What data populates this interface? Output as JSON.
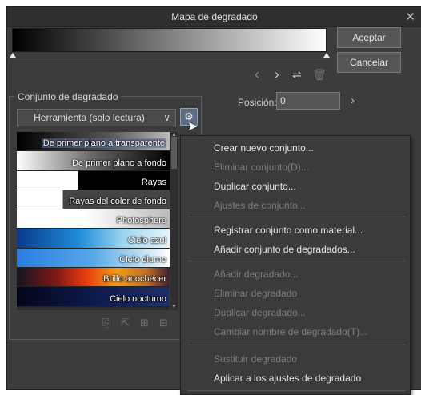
{
  "window": {
    "title": "Mapa de degradado",
    "close_glyph": "✕"
  },
  "buttons": {
    "ok": "Aceptar",
    "cancel": "Cancelar"
  },
  "nav": {
    "prev_glyph": "‹",
    "next_glyph": "›",
    "flip_glyph": "⇌",
    "trash_glyph": "🗑"
  },
  "position": {
    "label": "Posición:",
    "value": "0",
    "arrow": "›"
  },
  "gradient_set": {
    "group_label": "Conjunto de degradado",
    "selected": "Herramienta (solo lectura)",
    "chevron": "∨",
    "gear_glyph": "⚙",
    "items": [
      {
        "label": "De primer plano a transparente",
        "bg": "linear-gradient(to right,#000 0%,#555 60%,#bbb 100%)"
      },
      {
        "label": "De primer plano a fondo",
        "bg": "linear-gradient(to right,#ffffff 0%,#666 50%,#000 100%)"
      },
      {
        "label": "Rayas",
        "bg": "linear-gradient(to right,#ffffff 0%,#ffffff 40%,#000 40%,#000 100%)"
      },
      {
        "label": "Rayas del color de fondo",
        "bg": "linear-gradient(to right,#ffffff 0%,#ffffff 30%,#444 30%,#444 100%)"
      },
      {
        "label": "Photosphere",
        "bg": "linear-gradient(to right,#ffffff 0%,#ffffff 45%,#bbb 100%)"
      },
      {
        "label": "Cielo azul",
        "bg": "linear-gradient(to right,#0a3a8a 0%,#1e8ad8 40%,#9dd6f0 70%,#e8f4fa 100%)"
      },
      {
        "label": "Cielo diurno",
        "bg": "linear-gradient(to right,#2a7de0 0%,#57a8e8 50%,#b7dcf2 80%,#fff 100%)"
      },
      {
        "label": "Brillo anochecer",
        "bg": "linear-gradient(to right,#141420 0%,#7a1818 25%,#e83a10 45%,#f29a18 65%,#c0702a 85%,#402030 100%)"
      },
      {
        "label": "Cielo nocturno",
        "bg": "linear-gradient(to right,#05051a 0%,#0d1a4a 50%,#20306a 100%)"
      }
    ]
  },
  "context_menu": {
    "items": [
      {
        "label": "Crear nuevo conjunto...",
        "enabled": true
      },
      {
        "label": "Eliminar conjunto(D)...",
        "enabled": false
      },
      {
        "label": "Duplicar conjunto...",
        "enabled": true
      },
      {
        "label": "Ajustes de conjunto...",
        "enabled": false
      },
      {
        "label": "Registrar conjunto como material...",
        "enabled": true
      },
      {
        "label": "Añadir conjunto de degradados...",
        "enabled": true
      },
      {
        "label": "Añadir degradado...",
        "enabled": false
      },
      {
        "label": "Eliminar degradado",
        "enabled": false
      },
      {
        "label": "Duplicar degradado...",
        "enabled": false
      },
      {
        "label": "Cambiar nombre de degradado(T)...",
        "enabled": false
      },
      {
        "label": "Sustituir degradado",
        "enabled": false
      },
      {
        "label": "Aplicar a los ajustes de degradado",
        "enabled": true
      }
    ]
  }
}
